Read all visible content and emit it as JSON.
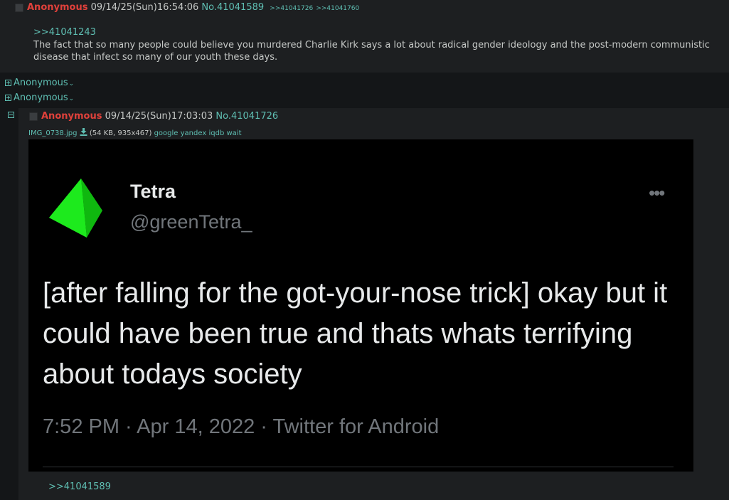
{
  "post1": {
    "name": "Anonymous",
    "date": "09/14/25(Sun)16:54:06",
    "number": "No.41041589",
    "backlinks": [
      ">>41041726",
      ">>41041760"
    ],
    "quote": ">>41041243",
    "message": "The fact that so many people could believe you murdered Charlie Kirk says a lot about radical gender ideology and the post-modern communistic disease that infect so many of our youth these days."
  },
  "hidden_posts": [
    {
      "name": "Anonymous"
    },
    {
      "name": "Anonymous"
    }
  ],
  "post2": {
    "name": "Anonymous",
    "date": "09/14/25(Sun)17:03:03",
    "number": "No.41041726",
    "file": {
      "filename": "IMG_0738.jpg",
      "info": "(54 KB, 935x467)",
      "search_links": [
        "google",
        "yandex",
        "iqdb",
        "wait"
      ]
    },
    "tweet": {
      "display_name": "Tetra",
      "handle": "@greenTetra_",
      "more": "•••",
      "text": "[after falling for the got-your-nose trick] okay but it could have been true and thats whats terrifying about todays society",
      "meta": "7:52 PM · Apr 14, 2022 · Twitter for Android",
      "avatar_color": "#22ee22"
    },
    "quote": ">>41041589"
  },
  "colors": {
    "name": "#e0413b",
    "link": "#5fbfb3",
    "post_bg": "#1d1f21",
    "page_bg": "#141618"
  }
}
